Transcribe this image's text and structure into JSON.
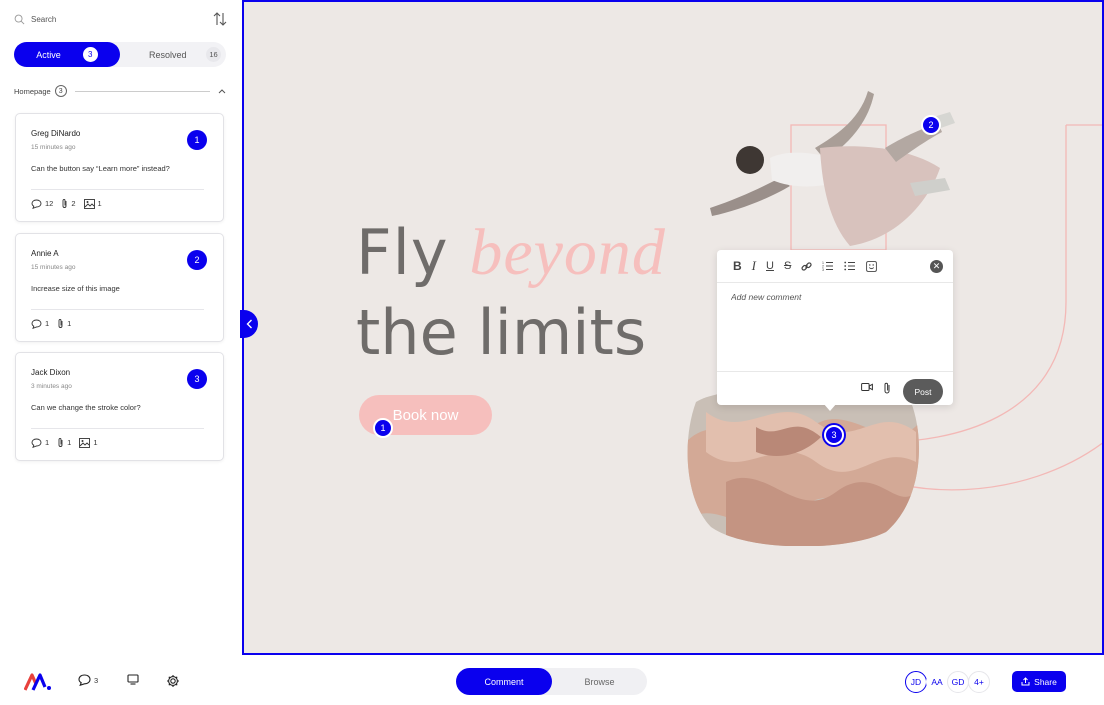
{
  "sidebar": {
    "search_placeholder": "Search",
    "tabs": {
      "active_label": "Active",
      "active_count": "3",
      "resolved_label": "Resolved",
      "resolved_count": "16"
    },
    "group": {
      "label": "Homepage",
      "count": "3"
    },
    "comments": [
      {
        "name": "Greg DiNardo",
        "time": "15 minutes ago",
        "text": "Can the button say “Learn more” instead?",
        "number": "1",
        "replies": "12",
        "attachments": "2",
        "images": "1"
      },
      {
        "name": "Annie A",
        "time": "15 minutes ago",
        "text": "Increase size of this image",
        "number": "2",
        "replies": "1",
        "attachments": "1"
      },
      {
        "name": "Jack Dixon",
        "time": "3 minutes ago",
        "text": "Can we change the stroke color?",
        "number": "3",
        "replies": "1",
        "attachments": "1",
        "images": "1"
      }
    ]
  },
  "canvas": {
    "headline_word1": "Fly",
    "headline_word2": "beyond",
    "headline_line2": "the limits",
    "cta_label": "Book now",
    "pins": [
      "1",
      "2",
      "3"
    ]
  },
  "popup": {
    "toolbar": [
      "bold-icon",
      "italic-icon",
      "underline-icon",
      "strikethrough-icon",
      "link-icon",
      "numbered-list-icon",
      "bullet-list-icon",
      "emoji-icon"
    ],
    "placeholder": "Add new comment",
    "post_label": "Post"
  },
  "bottom": {
    "comments_count": "3",
    "mode_comment": "Comment",
    "mode_browse": "Browse",
    "avatars": [
      "JD",
      "AA",
      "GD",
      "4+"
    ],
    "share_label": "Share"
  },
  "colors": {
    "accent": "#0a00ee",
    "pink": "#f6bfbd",
    "canvas_bg": "#ede8e5"
  }
}
